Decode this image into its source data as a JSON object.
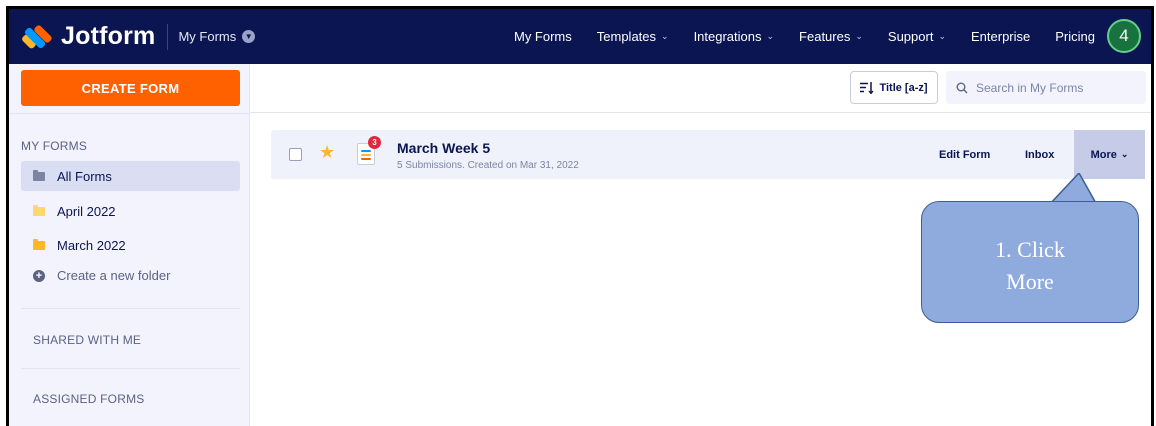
{
  "header": {
    "logo_text": "Jotform",
    "context_label": "My Forms",
    "nav": [
      {
        "label": "My Forms",
        "has_dropdown": false
      },
      {
        "label": "Templates",
        "has_dropdown": true
      },
      {
        "label": "Integrations",
        "has_dropdown": true
      },
      {
        "label": "Features",
        "has_dropdown": true
      },
      {
        "label": "Support",
        "has_dropdown": true
      },
      {
        "label": "Enterprise",
        "has_dropdown": false
      },
      {
        "label": "Pricing",
        "has_dropdown": false
      }
    ],
    "avatar_text": "4"
  },
  "sidebar": {
    "create_label": "CREATE FORM",
    "my_forms_title": "MY FORMS",
    "folders": [
      {
        "label": "All Forms",
        "active": true,
        "color": "#7d84a3"
      },
      {
        "label": "April 2022",
        "active": false,
        "color": "#ffd86b"
      },
      {
        "label": "March 2022",
        "active": false,
        "color": "#ffb629"
      }
    ],
    "add_folder_label": "Create a new folder",
    "shared_label": "SHARED WITH ME",
    "assigned_label": "ASSIGNED FORMS"
  },
  "toolbar": {
    "sort_label": "Title [a-z]",
    "search_placeholder": "Search in My Forms"
  },
  "form_row": {
    "title": "March Week 5",
    "meta": "5 Submissions. Created on Mar 31, 2022",
    "badge": "3",
    "edit_label": "Edit Form",
    "inbox_label": "Inbox",
    "more_label": "More"
  },
  "callout": {
    "line1": "1. Click",
    "line2": "More"
  },
  "colors": {
    "nav_bg": "#0a1551",
    "accent": "#ff6100",
    "callout": "#8faadc"
  }
}
